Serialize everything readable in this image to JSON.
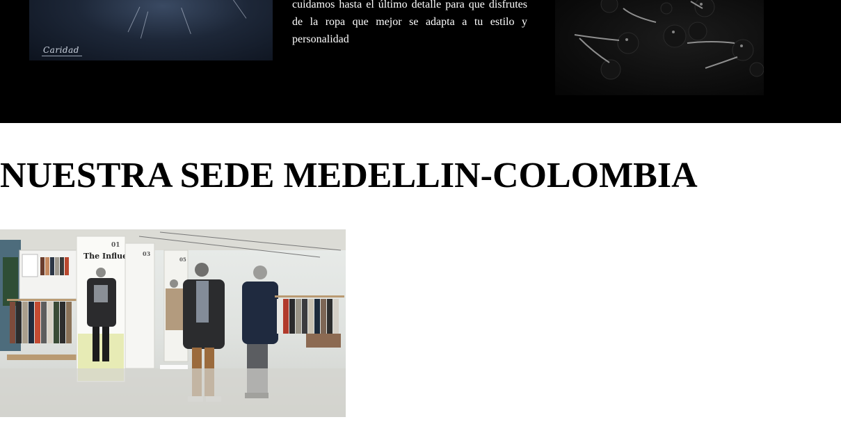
{
  "about": {
    "text": "cuidamos hasta el último detalle para que disfrutes de la ropa que mejor se adapta a tu estilo y personalidad",
    "portrait_signature": "Caridad"
  },
  "store_section": {
    "title": "NUESTRA SEDE MEDELLIN-COLOMBIA",
    "store_banner": {
      "heading": "The Influencers",
      "number": "01",
      "second_number": "03",
      "third_number": "05"
    }
  },
  "colors": {
    "band_background": "#000000",
    "page_background": "#ffffff",
    "title_color": "#000000"
  }
}
